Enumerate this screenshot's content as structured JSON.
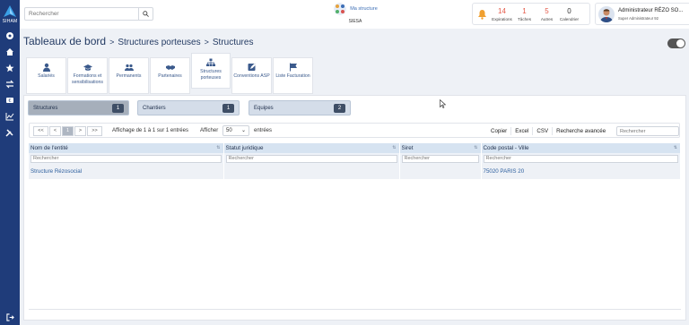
{
  "brand": {
    "name": "SIHAM"
  },
  "topbar": {
    "search_placeholder": "Rechercher",
    "structure": {
      "title": "Ma structure",
      "name": "SIESA"
    },
    "counters": [
      {
        "value": "14",
        "label": "Expirations"
      },
      {
        "value": "1",
        "label": "Tâches"
      },
      {
        "value": "5",
        "label": "Autres"
      },
      {
        "value": "0",
        "label": "Calendrier"
      }
    ],
    "user": {
      "name": "Administrateur RÉZO SO...",
      "role": "Super Administrateur 92"
    }
  },
  "breadcrumb": {
    "root": "Tableaux de bord",
    "parent": "Structures porteuses",
    "current": "Structures"
  },
  "tiles": [
    {
      "label": "Salariés",
      "icon": "user-icon"
    },
    {
      "label": "Formations et sensibilisations",
      "icon": "graduation-cap-icon"
    },
    {
      "label": "Permanents",
      "icon": "users-icon"
    },
    {
      "label": "Partenaires",
      "icon": "handshake-icon"
    },
    {
      "label": "Structures porteuses",
      "icon": "sitemap-icon"
    },
    {
      "label": "Conventions ASP",
      "icon": "edit-icon"
    },
    {
      "label": "Liste Facturation",
      "icon": "flag-icon"
    }
  ],
  "pills": [
    {
      "label": "Structures",
      "count": "1"
    },
    {
      "label": "Chantiers",
      "count": "1"
    },
    {
      "label": "Equipes",
      "count": "2"
    }
  ],
  "pager": {
    "first": "<<",
    "prev": "<",
    "page": "1",
    "next": ">",
    "last": ">>"
  },
  "page_info": "Affichage de 1 à 1 sur 1 entrées",
  "show_label": "Afficher",
  "page_size": "50",
  "entries_label": "entrées",
  "export": {
    "copy": "Copier",
    "excel": "Excel",
    "csv": "CSV",
    "advanced": "Recherche avancée"
  },
  "table_search_placeholder": "Rechercher",
  "table": {
    "columns": [
      "Nom de l'entité",
      "Statut juridique",
      "Siret",
      "Code postal - Ville"
    ],
    "filter_placeholder": "Rechercher",
    "rows": [
      [
        "Structure Rézosocial",
        "",
        "",
        "75020 PARIS 20"
      ]
    ]
  }
}
